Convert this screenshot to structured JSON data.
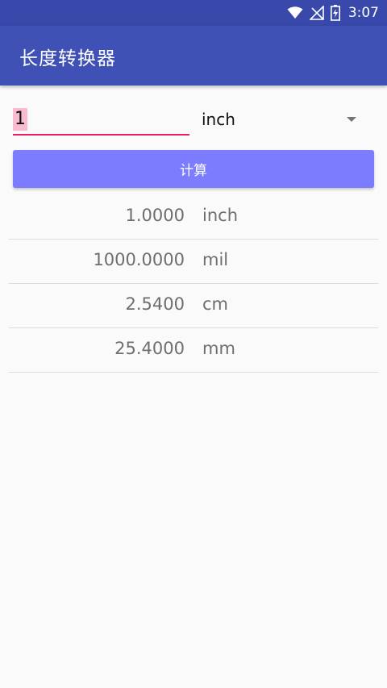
{
  "status_bar": {
    "time": "3:07",
    "icons": [
      "wifi-icon",
      "no-signal-icon",
      "battery-charging-icon"
    ]
  },
  "app_bar": {
    "title": "长度转换器"
  },
  "converter": {
    "input_value": "1",
    "selected_unit": "inch",
    "calculate_label": "计算"
  },
  "results": [
    {
      "value": "1.0000",
      "unit": "inch"
    },
    {
      "value": "1000.0000",
      "unit": "mil"
    },
    {
      "value": "2.5400",
      "unit": "cm"
    },
    {
      "value": "25.4000",
      "unit": "mm"
    }
  ],
  "colors": {
    "status_bar": "#3949ab",
    "app_bar": "#3f51b5",
    "input_underline": "#e91e63",
    "input_highlight": "#f8bbd0",
    "button": "#7c7cff",
    "background": "#fafafa",
    "result_text": "#6e6e6e"
  }
}
